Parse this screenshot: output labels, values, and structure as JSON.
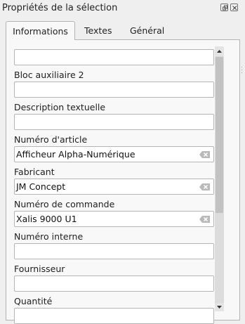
{
  "panel": {
    "title": "Propriétés de la sélection",
    "float_icon": "float-icon",
    "close_icon": "close-icon"
  },
  "tabs": [
    {
      "label": "Informations",
      "active": true
    },
    {
      "label": "Textes",
      "active": false
    },
    {
      "label": "Général",
      "active": false
    }
  ],
  "fields": {
    "top": {
      "value": ""
    },
    "bloc_auxiliaire_2": {
      "label": "Bloc auxiliaire 2",
      "value": ""
    },
    "description_textuelle": {
      "label": "Description textuelle",
      "value": ""
    },
    "numero_article": {
      "label": "Numéro d'article",
      "value": "Afficheur Alpha-Numérique"
    },
    "fabricant": {
      "label": "Fabricant",
      "value": "JM Concept"
    },
    "numero_commande": {
      "label": "Numéro de commande",
      "value": "Xalis 9000 U1"
    },
    "numero_interne": {
      "label": "Numéro interne",
      "value": ""
    },
    "fournisseur": {
      "label": "Fournisseur",
      "value": ""
    },
    "quantite": {
      "label": "Quantité",
      "value": ""
    }
  },
  "colors": {
    "background": "#efefef",
    "panel": "#f8f8f8",
    "input_border": "#b5b5b5",
    "clear_icon": "#b9b9b9"
  }
}
